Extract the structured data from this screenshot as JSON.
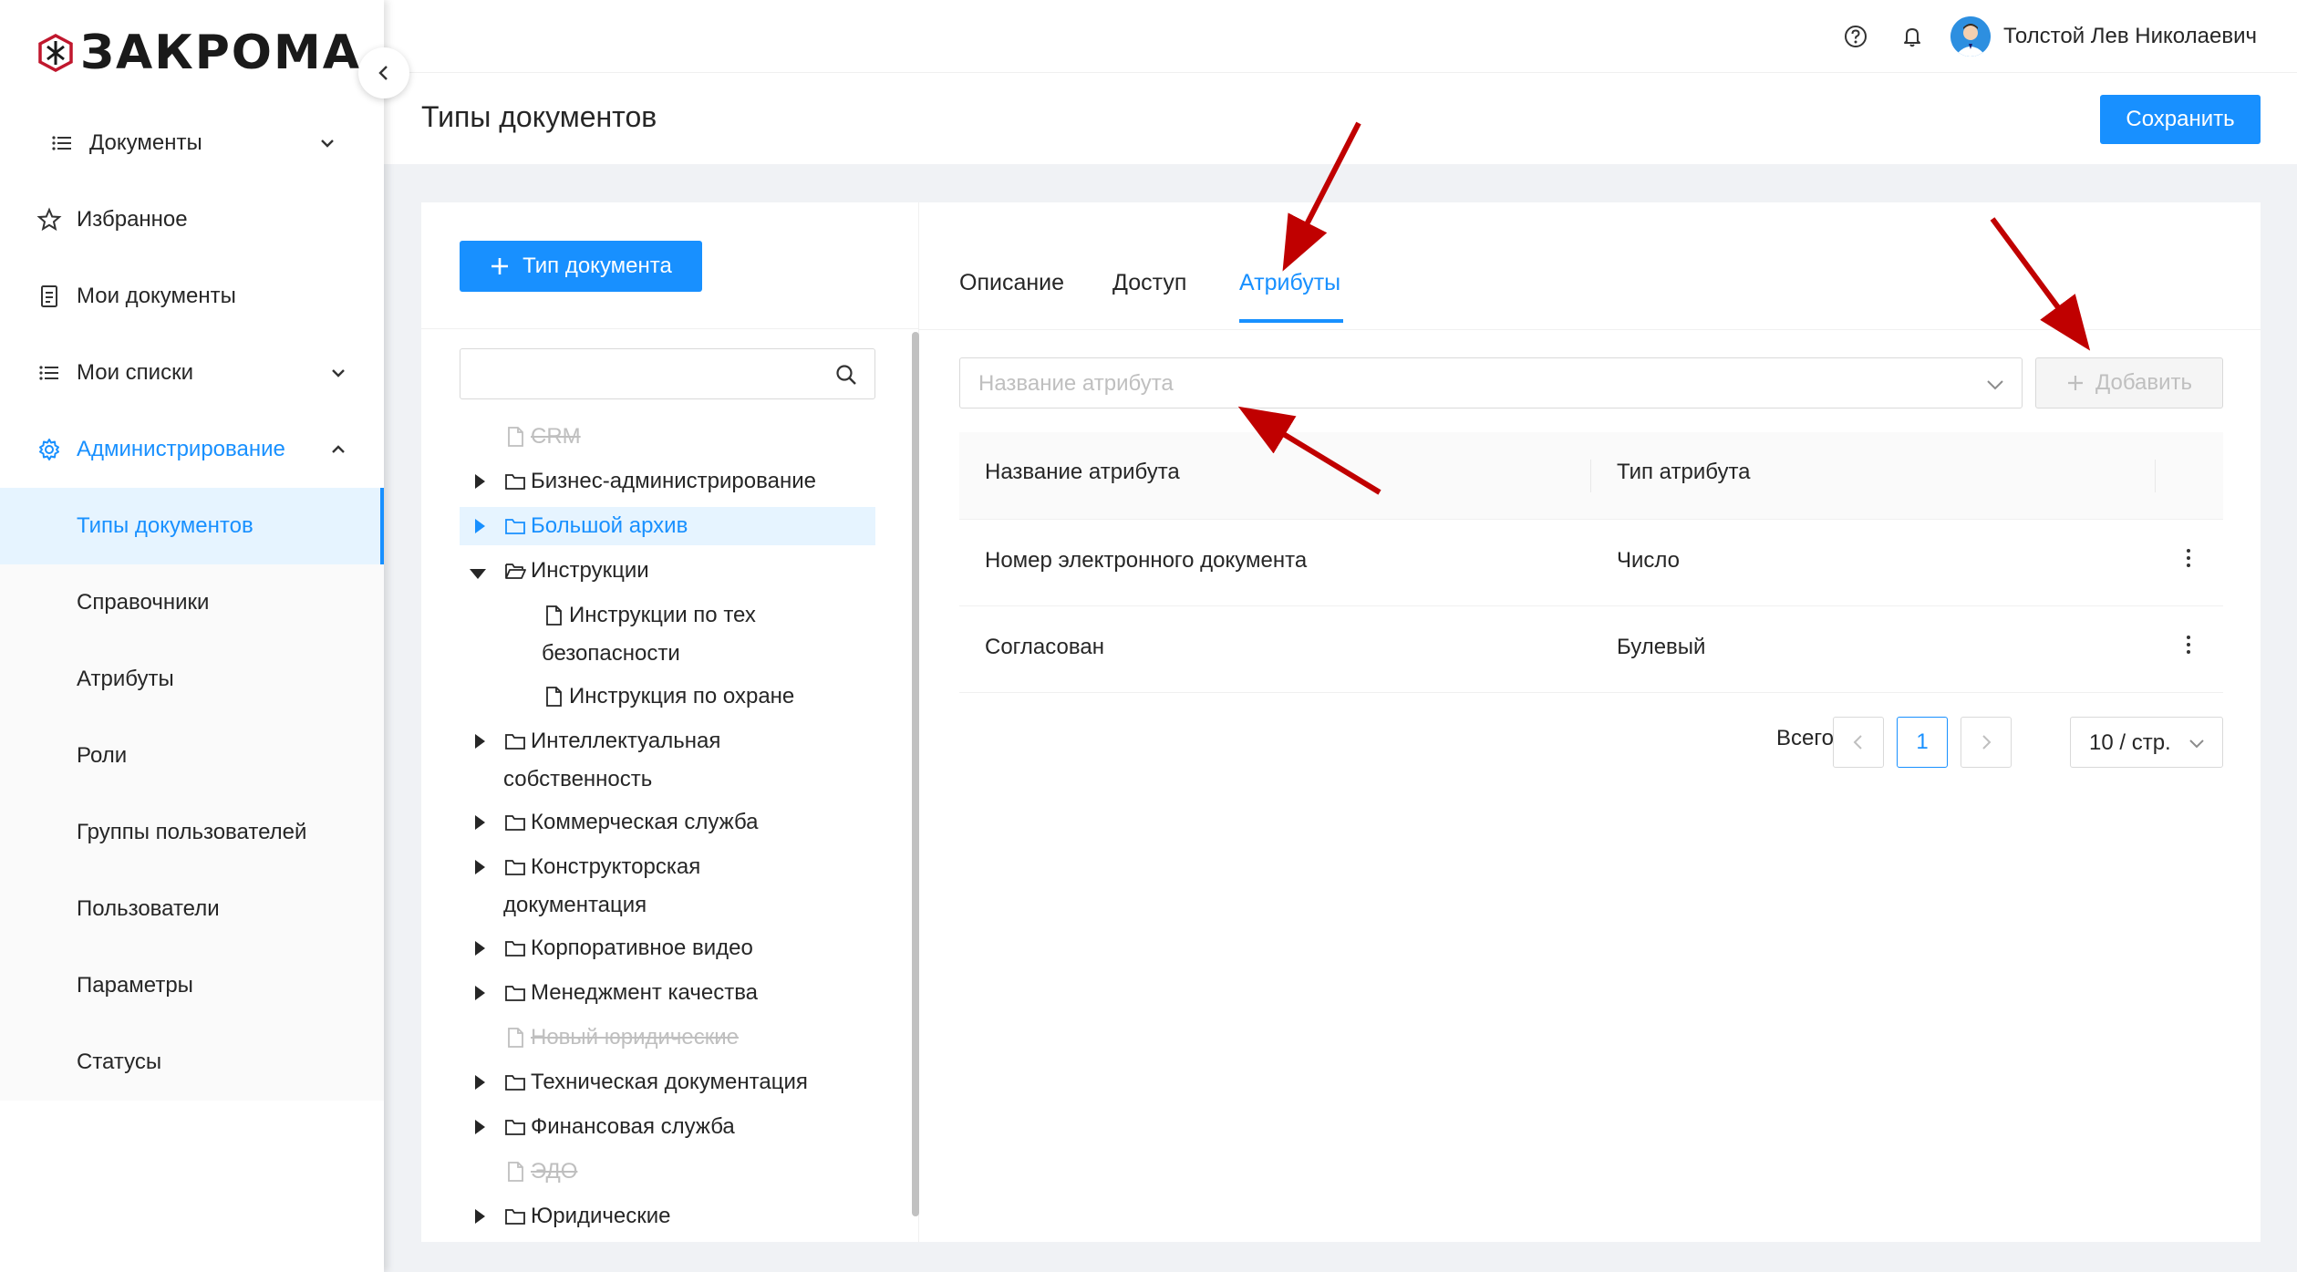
{
  "brand": {
    "name": "ЗАКРОМА"
  },
  "sidebar": {
    "items": [
      {
        "label": "Документы",
        "icon": "list-icon",
        "expandable": true
      },
      {
        "label": "Избранное",
        "icon": "star-icon"
      },
      {
        "label": "Мои документы",
        "icon": "document-icon"
      },
      {
        "label": "Мои списки",
        "icon": "list-icon",
        "expandable": true
      },
      {
        "label": "Администрирование",
        "icon": "gear-icon",
        "expanded": true,
        "active": true
      }
    ],
    "admin_sub": [
      {
        "label": "Типы документов",
        "selected": true
      },
      {
        "label": "Справочники"
      },
      {
        "label": "Атрибуты"
      },
      {
        "label": "Роли"
      },
      {
        "label": "Группы пользователей"
      },
      {
        "label": "Пользователи"
      },
      {
        "label": "Параметры"
      },
      {
        "label": "Статусы"
      }
    ]
  },
  "header": {
    "user_name": "Толстой Лев Николаевич"
  },
  "page": {
    "title": "Типы документов",
    "save_label": "Сохранить"
  },
  "left_panel": {
    "add_type_label": "Тип документа",
    "search_placeholder": "",
    "tree": [
      {
        "label": "CRM",
        "type": "file",
        "disabled": true
      },
      {
        "label": "Бизнес-администрирование",
        "type": "folder",
        "collapsed": true
      },
      {
        "label": "Большой архив",
        "type": "folder",
        "collapsed": true,
        "selected": true
      },
      {
        "label": "Инструкции",
        "type": "folder-open",
        "expanded": true
      },
      {
        "label": "Инструкции по тех",
        "label_line2": "безопасности",
        "type": "file",
        "child": true
      },
      {
        "label": "Инструкция по охране",
        "type": "file",
        "child": true
      },
      {
        "label": "Интеллектуальная",
        "label_line2": "собственность",
        "type": "folder",
        "collapsed": true
      },
      {
        "label": "Коммерческая служба",
        "type": "folder",
        "collapsed": true
      },
      {
        "label": "Конструкторская",
        "label_line2": "документация",
        "type": "folder",
        "collapsed": true
      },
      {
        "label": "Корпоративное видео",
        "type": "folder",
        "collapsed": true
      },
      {
        "label": "Менеджмент качества",
        "type": "folder",
        "collapsed": true
      },
      {
        "label": "Новый юридические",
        "type": "file",
        "disabled": true
      },
      {
        "label": "Техническая документация",
        "type": "folder",
        "collapsed": true
      },
      {
        "label": "Финансовая служба",
        "type": "folder",
        "collapsed": true
      },
      {
        "label": "ЭДО",
        "type": "file",
        "disabled": true
      },
      {
        "label": "Юридические",
        "type": "folder",
        "collapsed": true
      }
    ]
  },
  "right_panel": {
    "tabs": [
      {
        "label": "Описание"
      },
      {
        "label": "Доступ"
      },
      {
        "label": "Атрибуты",
        "active": true
      }
    ],
    "attribute_select_placeholder": "Название атрибута",
    "add_label": "Добавить",
    "table": {
      "columns": [
        "Название атрибута",
        "Тип атрибута"
      ],
      "rows": [
        {
          "name": "Номер электронного документа",
          "type": "Число"
        },
        {
          "name": "Согласован",
          "type": "Булевый"
        }
      ]
    },
    "pagination": {
      "total_label": "Всего 2",
      "current_page": "1",
      "page_size_label": "10 / стр."
    }
  },
  "colors": {
    "primary": "#1890ff",
    "annotation_arrow": "#c00000",
    "disabled_text": "#bfbfbf",
    "selected_bg": "#e6f4ff"
  }
}
